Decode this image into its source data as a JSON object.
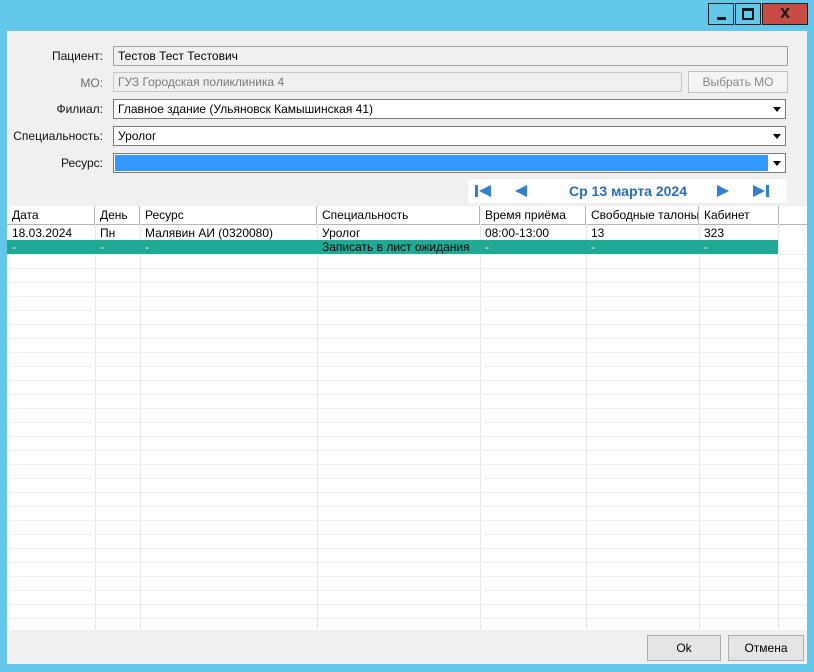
{
  "window": {
    "controls": {
      "minimize": "minimize",
      "maximize": "maximize",
      "close": "X"
    }
  },
  "form": {
    "patient_label": "Пациент:",
    "patient_value": "Тестов Тест Тестович",
    "mo_label": "МО:",
    "mo_value": "ГУЗ Городская поликлиника 4",
    "mo_button": "Выбрать МО",
    "branch_label": "Филиал:",
    "branch_value": "Главное здание (Ульяновск Камышинская 41)",
    "specialty_label": "Специальность:",
    "specialty_value": "Уролог",
    "resource_label": "Ресурс:",
    "resource_value": ""
  },
  "nav": {
    "date": "Ср 13 марта 2024",
    "icons": [
      "first-page-icon",
      "prev-icon",
      "next-icon",
      "last-page-icon"
    ]
  },
  "grid": {
    "columns": [
      "Дата",
      "День",
      "Ресурс",
      "Специальность",
      "Время приёма",
      "Свободные талоны",
      "Кабинет"
    ],
    "rows": [
      [
        "18.03.2024",
        "Пн",
        "Малявин АИ (0320080)",
        "Уролог",
        "08:00-13:00",
        "13",
        "323"
      ],
      [
        "-",
        "-",
        "-",
        "Записать в лист ожидания",
        "-",
        "-",
        "-"
      ]
    ]
  },
  "footer": {
    "ok": "Ok",
    "cancel": "Отмена"
  },
  "colors": {
    "window_frame": "#63c7ea",
    "close_button": "#c84c43",
    "selection_blue": "#3399ff",
    "selected_row": "#20aa96",
    "nav_text": "#2a6eb8"
  }
}
